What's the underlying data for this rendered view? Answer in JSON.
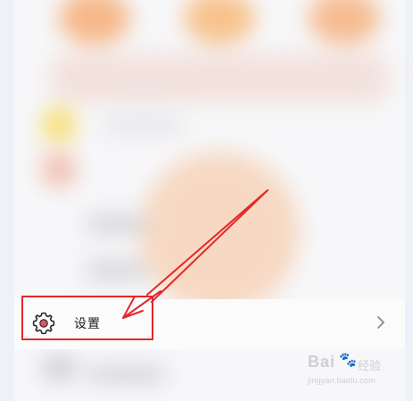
{
  "settings": {
    "label": "设置"
  },
  "watermark": {
    "brand": "Bai",
    "paw": "🐾",
    "sub": "经验",
    "url": "jingyan.baidu.com"
  },
  "colors": {
    "highlight": "#e3282a",
    "gear_fill": "#e0536f"
  },
  "icons": {
    "settings": "gear-icon",
    "chevron": "chevron-right-icon"
  }
}
